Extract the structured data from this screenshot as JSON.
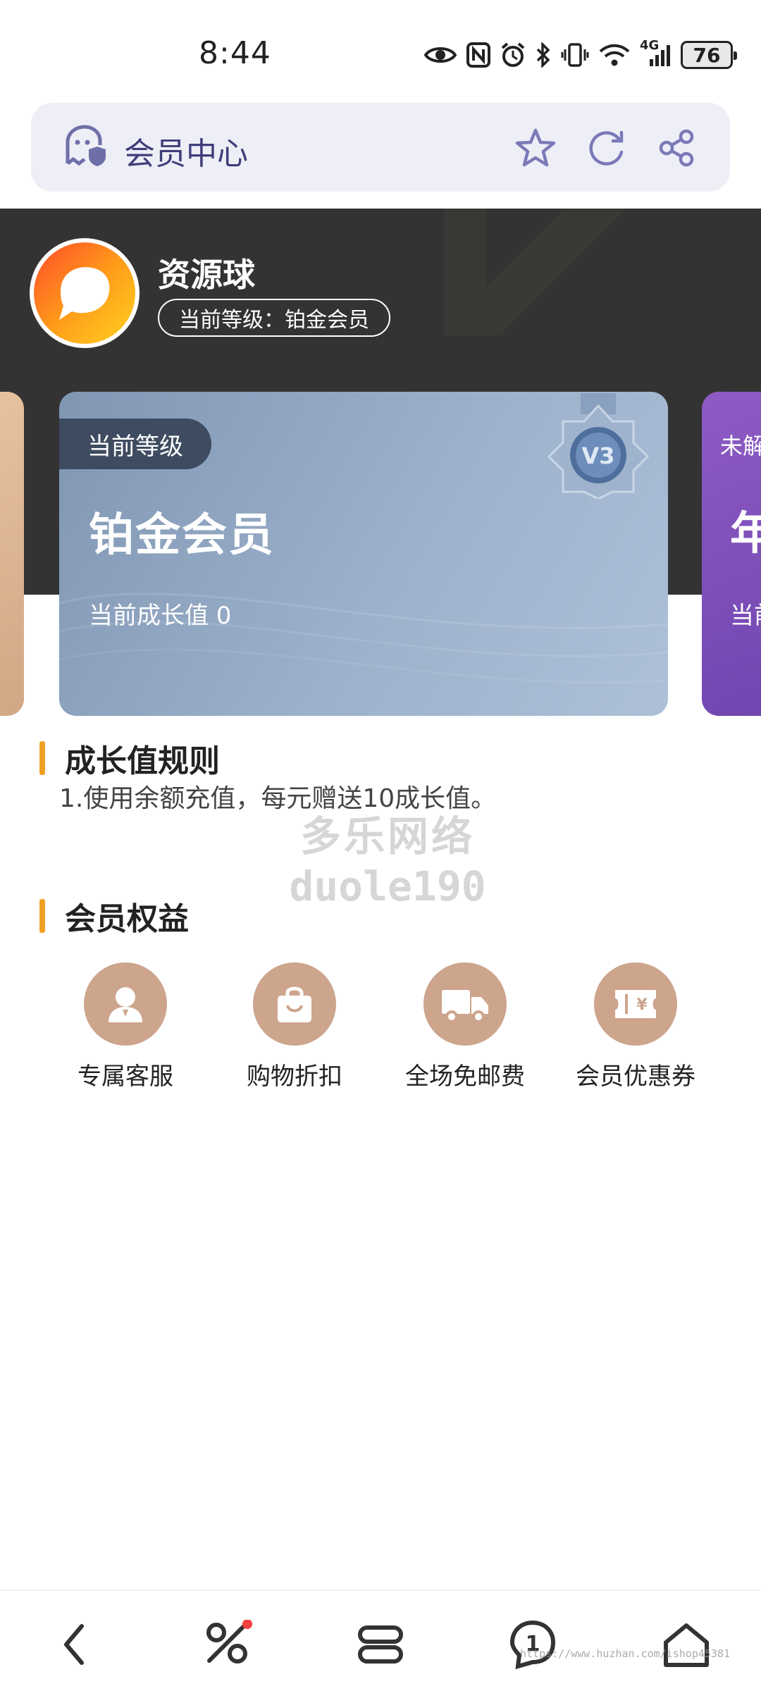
{
  "status_bar": {
    "time": "8:44",
    "network": "4G",
    "battery": "76"
  },
  "address_bar": {
    "title": "会员中心",
    "icons": [
      "shield-ghost-icon",
      "star-icon",
      "refresh-icon",
      "share-icon"
    ]
  },
  "profile": {
    "username": "资源球",
    "level_label": "当前等级：铂金会员"
  },
  "cards": {
    "current": {
      "tag": "当前等级",
      "level": "铂金会员",
      "growth": "当前成长值 0",
      "medal_text": "V3"
    },
    "next": {
      "tag": "未解",
      "level": "年",
      "growth": "当前"
    }
  },
  "growth_rules": {
    "title": "成长值规则",
    "text": "1.使用余额充值，每元赠送10成长值。"
  },
  "watermark": {
    "line1": "多乐网络",
    "line2": "duole190"
  },
  "benefits": {
    "title": "会员权益",
    "items": [
      {
        "label": "专属客服",
        "icon": "customer-service-icon"
      },
      {
        "label": "购物折扣",
        "icon": "shopping-bag-icon"
      },
      {
        "label": "全场免邮费",
        "icon": "delivery-truck-icon"
      },
      {
        "label": "会员优惠券",
        "icon": "coupon-icon"
      }
    ]
  },
  "bottom_nav": {
    "tab_count": "1",
    "url_watermark": "https://www.huzhan.com/ishop45381"
  },
  "colors": {
    "accent_bar": "#f0a020",
    "dark_header": "#333333",
    "benefit_icon_bg": "#cda48c",
    "address_text": "#3e3e7a"
  }
}
